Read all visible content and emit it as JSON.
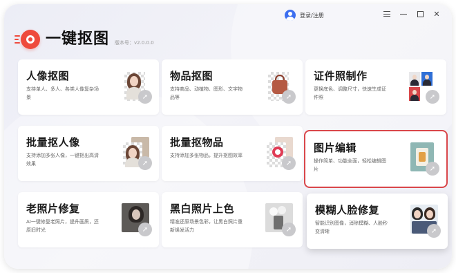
{
  "header": {
    "login_label": "登录/注册",
    "app_title": "一键抠图",
    "version_label": "版本号：v2.0.0.0"
  },
  "colors": {
    "brand_red": "#ee4a3c",
    "highlight_border": "#d9464a",
    "avatar_blue": "#3d6ff0"
  },
  "cards": [
    {
      "title": "人像抠图",
      "desc": "支持单人、多人、各类人像复杂场景",
      "icon": "portrait-cutout-thumbnail"
    },
    {
      "title": "物品抠图",
      "desc": "支持商品、动植物、图形、文字物品等",
      "icon": "handbag-cutout-thumbnail"
    },
    {
      "title": "证件照制作",
      "desc": "更换底色、调整尺寸，快速生成证件照",
      "icon": "id-photo-thumbnail"
    },
    {
      "title": "批量抠人像",
      "desc": "支持添加多张人像，一键抠出高清效果",
      "icon": "batch-portrait-thumbnail"
    },
    {
      "title": "批量抠物品",
      "desc": "支持添加多张物品，提升抠图效率",
      "icon": "batch-items-thumbnail"
    },
    {
      "title": "图片编辑",
      "desc": "操作简单、功能全面，轻松编辑图片",
      "icon": "image-edit-thumbnail",
      "selected": true
    },
    {
      "title": "老照片修复",
      "desc": "AI一键修复老照片，提升画质，还原旧时光",
      "icon": "old-photo-thumbnail"
    },
    {
      "title": "黑白照片上色",
      "desc": "精准还原场景色彩，让黑白照片重新焕发活力",
      "icon": "colorize-thumbnail"
    },
    {
      "title": "模糊人脸修复",
      "desc": "智能识别图像，消除模糊、人脸秒变清晰",
      "icon": "face-restore-thumbnail",
      "hovered": true
    }
  ]
}
